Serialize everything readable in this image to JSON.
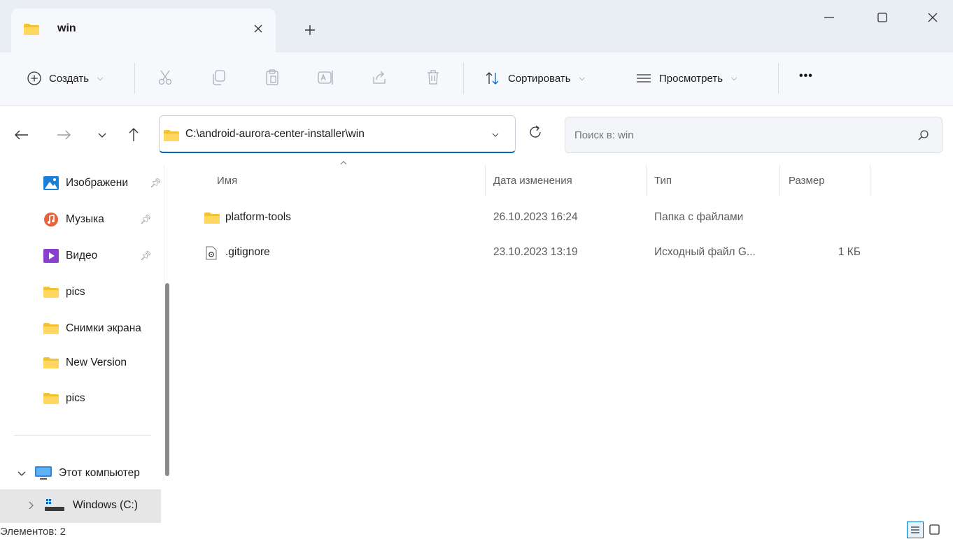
{
  "tab": {
    "title": "win",
    "icon": "folder-icon"
  },
  "window": {
    "minimize_icon": "minimize-icon",
    "maximize_icon": "maximize-icon",
    "close_icon": "close-icon"
  },
  "toolbar": {
    "create_label": "Создать",
    "sort_label": "Сортировать",
    "view_label": "Просмотреть",
    "more_label": "•••"
  },
  "address": {
    "path": "C:\\android-aurora-center-installer\\win"
  },
  "search": {
    "placeholder": "Поиск в: win"
  },
  "sidebar": {
    "items": [
      {
        "label": "Изображени",
        "icon": "pictures-icon",
        "pinned": true
      },
      {
        "label": "Музыка",
        "icon": "music-icon",
        "pinned": true
      },
      {
        "label": "Видео",
        "icon": "video-icon",
        "pinned": true
      },
      {
        "label": "pics",
        "icon": "folder-icon",
        "pinned": false
      },
      {
        "label": "Снимки экрана",
        "icon": "folder-icon",
        "pinned": false
      },
      {
        "label": "New Version",
        "icon": "folder-icon",
        "pinned": false
      },
      {
        "label": "pics",
        "icon": "folder-icon",
        "pinned": false
      }
    ],
    "this_pc": "Этот компьютер",
    "drive": "Windows (C:)"
  },
  "columns": {
    "name": "Имя",
    "date": "Дата изменения",
    "type": "Тип",
    "size": "Размер"
  },
  "files": [
    {
      "name": "platform-tools",
      "date": "26.10.2023 16:24",
      "type": "Папка с файлами",
      "size": "",
      "icon": "folder-icon"
    },
    {
      "name": ".gitignore",
      "date": "23.10.2023 13:19",
      "type": "Исходный файл G...",
      "size": "1 КБ",
      "icon": "config-file-icon"
    }
  ],
  "status": {
    "items": "Элементов: 2"
  }
}
